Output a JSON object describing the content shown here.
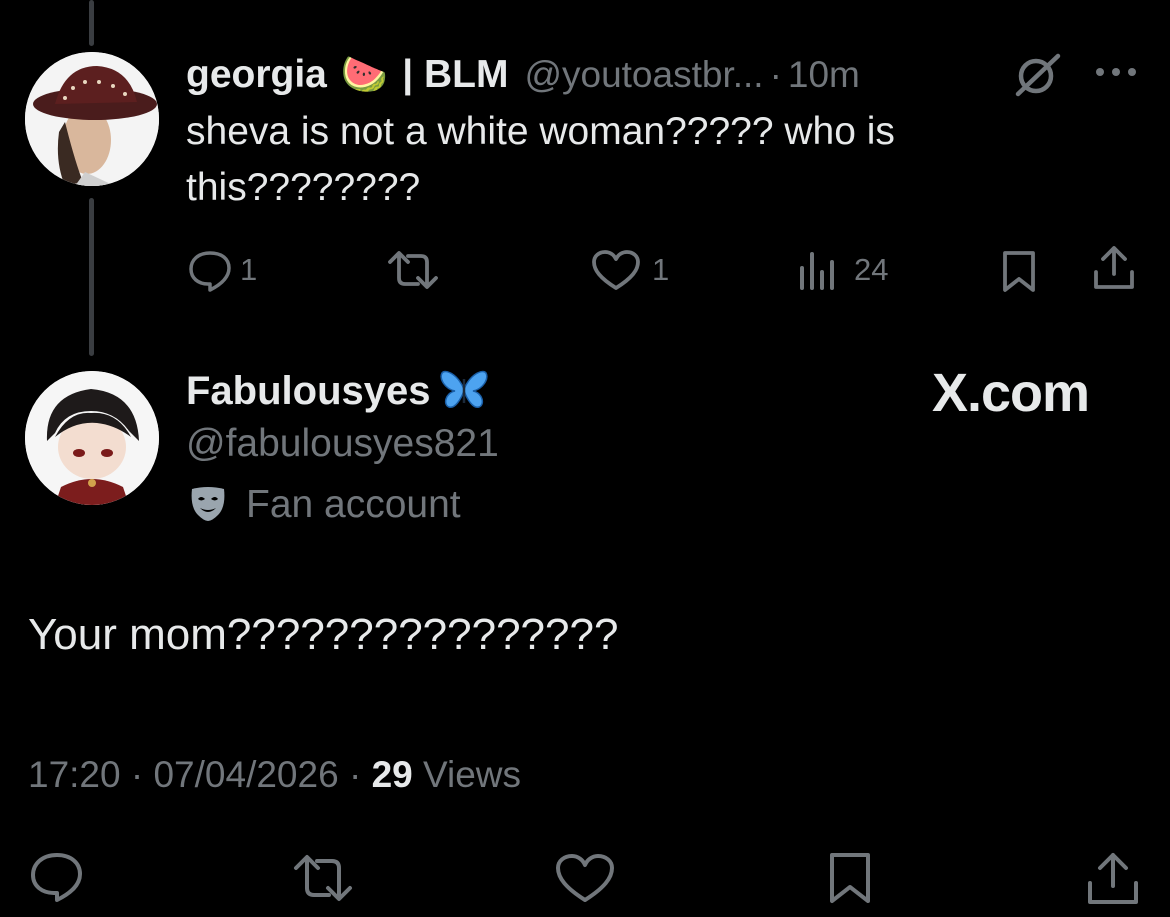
{
  "parent_tweet": {
    "display_name": "georgia",
    "name_emoji": "🍉",
    "name_suffix": "| BLM",
    "handle": "@youtoastbr...",
    "separator": "·",
    "time_ago": "10m",
    "text": "sheva is not a white woman????? who is this????????",
    "replies": "1",
    "likes": "1",
    "views": "24"
  },
  "reply_tweet": {
    "display_name": "Fabulousyes",
    "handle": "@fabulousyes821",
    "label": "Fan account",
    "text": "Your mom????????????????",
    "time": "17:20",
    "sep1": "·",
    "date": "07/04/2026",
    "sep2": "·",
    "views_count": "29",
    "views_label": "Views"
  },
  "watermark": "X.com",
  "colors": {
    "background": "#000000",
    "text": "#e7e9ea",
    "muted": "#71767b",
    "thread_line": "#3a3d41"
  },
  "icons": [
    "grok-icon",
    "more-icon",
    "reply-icon",
    "retweet-icon",
    "like-icon",
    "views-icon",
    "bookmark-icon",
    "share-icon",
    "butterfly-icon",
    "mask-icon"
  ]
}
